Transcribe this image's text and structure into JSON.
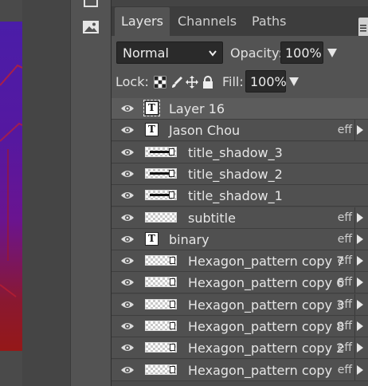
{
  "panel": {
    "tabs": [
      {
        "label": "Layers",
        "active": true
      },
      {
        "label": "Channels",
        "active": false
      },
      {
        "label": "Paths",
        "active": false
      }
    ],
    "blend_mode": "Normal",
    "opacity_label": "Opacity:",
    "opacity_value": "100%",
    "lock_label": "Lock:",
    "fill_label": "Fill:",
    "fill_value": "100%"
  },
  "layers": [
    {
      "name": "Layer 16",
      "type": "text",
      "selected": true,
      "indent": false,
      "eff": ""
    },
    {
      "name": "Jason Chou",
      "type": "text",
      "selected": false,
      "indent": false,
      "eff": "eff"
    },
    {
      "name": "title_shadow_3",
      "type": "shadow",
      "selected": false,
      "indent": true,
      "eff": ""
    },
    {
      "name": "title_shadow_2",
      "type": "shadow",
      "selected": false,
      "indent": true,
      "eff": ""
    },
    {
      "name": "title_shadow_1",
      "type": "shadow",
      "selected": false,
      "indent": true,
      "eff": ""
    },
    {
      "name": "subtitle",
      "type": "transparent",
      "selected": false,
      "indent": true,
      "eff": "eff"
    },
    {
      "name": "binary",
      "type": "text",
      "selected": false,
      "indent": false,
      "eff": "eff"
    },
    {
      "name": "Hexagon_pattern copy 7",
      "type": "hex",
      "selected": false,
      "indent": true,
      "eff": "eff"
    },
    {
      "name": "Hexagon_pattern copy 6",
      "type": "hex",
      "selected": false,
      "indent": true,
      "eff": "eff"
    },
    {
      "name": "Hexagon_pattern copy 3",
      "type": "hex",
      "selected": false,
      "indent": true,
      "eff": "eff"
    },
    {
      "name": "Hexagon_pattern copy 8",
      "type": "hex",
      "selected": false,
      "indent": true,
      "eff": "eff"
    },
    {
      "name": "Hexagon_pattern copy 2",
      "type": "hex",
      "selected": false,
      "indent": true,
      "eff": "eff"
    },
    {
      "name": "Hexagon_pattern copy",
      "type": "hex",
      "selected": false,
      "indent": true,
      "eff": "eff"
    }
  ],
  "icons": {
    "visibility": "eye-icon",
    "tool_top": "layers-tool-icon",
    "tool_image": "image-icon",
    "lock_transparency": "checkerboard-lock-icon",
    "lock_paint": "brush-lock-icon",
    "lock_move": "move-lock-icon",
    "lock_all": "padlock-icon"
  }
}
